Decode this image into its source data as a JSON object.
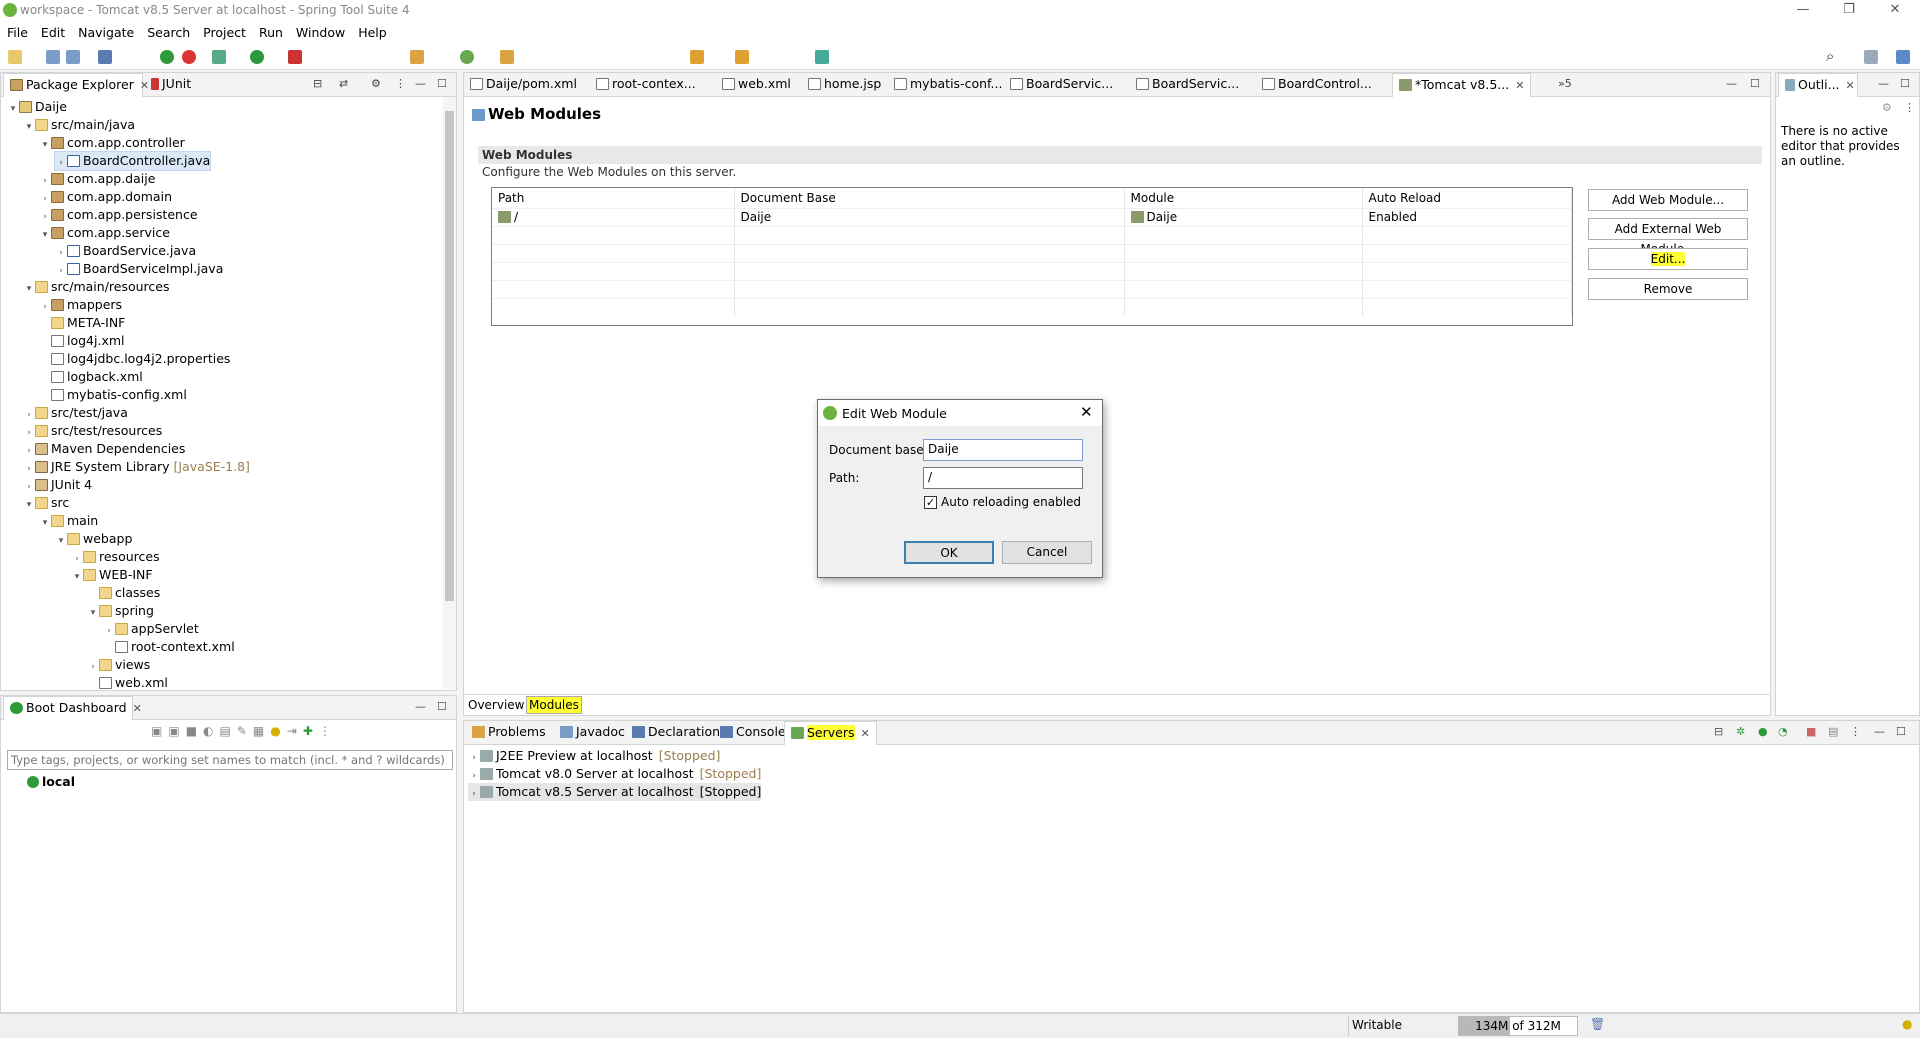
{
  "window": {
    "title": "workspace - Tomcat v8.5 Server at localhost - Spring Tool Suite 4"
  },
  "menu": [
    "File",
    "Edit",
    "Navigate",
    "Search",
    "Project",
    "Run",
    "Window",
    "Help"
  ],
  "left_panel": {
    "tabs": [
      {
        "label": "Package Explorer"
      },
      {
        "label": "JUnit"
      }
    ],
    "tree": [
      {
        "label": "Daije",
        "indent": 0,
        "tw": "v",
        "icon": "proj"
      },
      {
        "label": "src/main/java",
        "indent": 1,
        "tw": "v",
        "icon": "fold"
      },
      {
        "label": "com.app.controller",
        "indent": 2,
        "tw": "v",
        "icon": "pkg"
      },
      {
        "label": "BoardController.java",
        "indent": 3,
        "tw": ">",
        "icon": "java",
        "selected": true
      },
      {
        "label": "com.app.daije",
        "indent": 2,
        "tw": ">",
        "icon": "pkg"
      },
      {
        "label": "com.app.domain",
        "indent": 2,
        "tw": ">",
        "icon": "pkg"
      },
      {
        "label": "com.app.persistence",
        "indent": 2,
        "tw": ">",
        "icon": "pkg"
      },
      {
        "label": "com.app.service",
        "indent": 2,
        "tw": "v",
        "icon": "pkg"
      },
      {
        "label": "BoardService.java",
        "indent": 3,
        "tw": ">",
        "icon": "java"
      },
      {
        "label": "BoardServiceImpl.java",
        "indent": 3,
        "tw": ">",
        "icon": "java"
      },
      {
        "label": "src/main/resources",
        "indent": 1,
        "tw": "v",
        "icon": "fold"
      },
      {
        "label": "mappers",
        "indent": 2,
        "tw": ">",
        "icon": "pkg"
      },
      {
        "label": "META-INF",
        "indent": 2,
        "tw": "",
        "icon": "fold"
      },
      {
        "label": "log4j.xml",
        "indent": 2,
        "tw": "",
        "icon": "file"
      },
      {
        "label": "log4jdbc.log4j2.properties",
        "indent": 2,
        "tw": "",
        "icon": "file"
      },
      {
        "label": "logback.xml",
        "indent": 2,
        "tw": "",
        "icon": "file"
      },
      {
        "label": "mybatis-config.xml",
        "indent": 2,
        "tw": "",
        "icon": "file"
      },
      {
        "label": "src/test/java",
        "indent": 1,
        "tw": ">",
        "icon": "fold"
      },
      {
        "label": "src/test/resources",
        "indent": 1,
        "tw": ">",
        "icon": "fold"
      },
      {
        "label": "Maven Dependencies",
        "indent": 1,
        "tw": ">",
        "icon": "jar"
      },
      {
        "label": "JRE System Library",
        "decor": "[JavaSE-1.8]",
        "indent": 1,
        "tw": ">",
        "icon": "jar"
      },
      {
        "label": "JUnit 4",
        "indent": 1,
        "tw": ">",
        "icon": "jar"
      },
      {
        "label": "src",
        "indent": 1,
        "tw": "v",
        "icon": "fold"
      },
      {
        "label": "main",
        "indent": 2,
        "tw": "v",
        "icon": "fold"
      },
      {
        "label": "webapp",
        "indent": 3,
        "tw": "v",
        "icon": "fold"
      },
      {
        "label": "resources",
        "indent": 4,
        "tw": ">",
        "icon": "fold"
      },
      {
        "label": "WEB-INF",
        "indent": 4,
        "tw": "v",
        "icon": "fold"
      },
      {
        "label": "classes",
        "indent": 5,
        "tw": "",
        "icon": "fold"
      },
      {
        "label": "spring",
        "indent": 5,
        "tw": "v",
        "icon": "fold"
      },
      {
        "label": "appServlet",
        "indent": 6,
        "tw": ">",
        "icon": "fold"
      },
      {
        "label": "root-context.xml",
        "indent": 6,
        "tw": "",
        "icon": "file"
      },
      {
        "label": "views",
        "indent": 5,
        "tw": ">",
        "icon": "fold"
      },
      {
        "label": "web.xml",
        "indent": 5,
        "tw": "",
        "icon": "file"
      }
    ]
  },
  "boot_dashboard": {
    "tab": "Boot Dashboard",
    "filter_placeholder": "Type tags, projects, or working set names to match (incl. * and ? wildcards)",
    "item": "local"
  },
  "editor": {
    "tabs": [
      "Daije/pom.xml",
      "root-contex...",
      "web.xml",
      "home.jsp",
      "mybatis-conf...",
      "BoardServic...",
      "BoardServic...",
      "BoardControl...",
      "*Tomcat v8.5..."
    ],
    "more": "»5",
    "heading": "Web Modules",
    "section_title": "Web Modules",
    "section_desc": "Configure the Web Modules on this server.",
    "columns": [
      "Path",
      "Document Base",
      "Module",
      "Auto Reload"
    ],
    "rows": [
      {
        "path": "/",
        "docbase": "Daije",
        "module": "Daije",
        "reload": "Enabled"
      }
    ],
    "buttons": {
      "add": "Add Web Module...",
      "add_external": "Add External Web Module...",
      "edit": "Edit...",
      "remove": "Remove"
    },
    "bottom_tabs": [
      "Overview",
      "Modules"
    ]
  },
  "outline": {
    "tab": "Outli...",
    "message": "There is no active editor that provides an outline."
  },
  "servers_panel": {
    "tabs": [
      "Problems",
      "Javadoc",
      "Declaration",
      "Console",
      "Servers"
    ],
    "servers": [
      {
        "name": "J2EE Preview at localhost",
        "status": "[Stopped]"
      },
      {
        "name": "Tomcat v8.0 Server at localhost",
        "status": "[Stopped]"
      },
      {
        "name": "Tomcat v8.5 Server at localhost",
        "status": "[Stopped]"
      }
    ]
  },
  "dialog": {
    "title": "Edit Web Module",
    "docbase_label": "Document base:",
    "docbase_value": "Daije",
    "path_label": "Path:",
    "path_value": "/",
    "checkbox_label": "Auto reloading enabled",
    "ok": "OK",
    "cancel": "Cancel"
  },
  "status": {
    "writable": "Writable",
    "heap": "134M of 312M",
    "heap_used_fraction": 0.43
  }
}
